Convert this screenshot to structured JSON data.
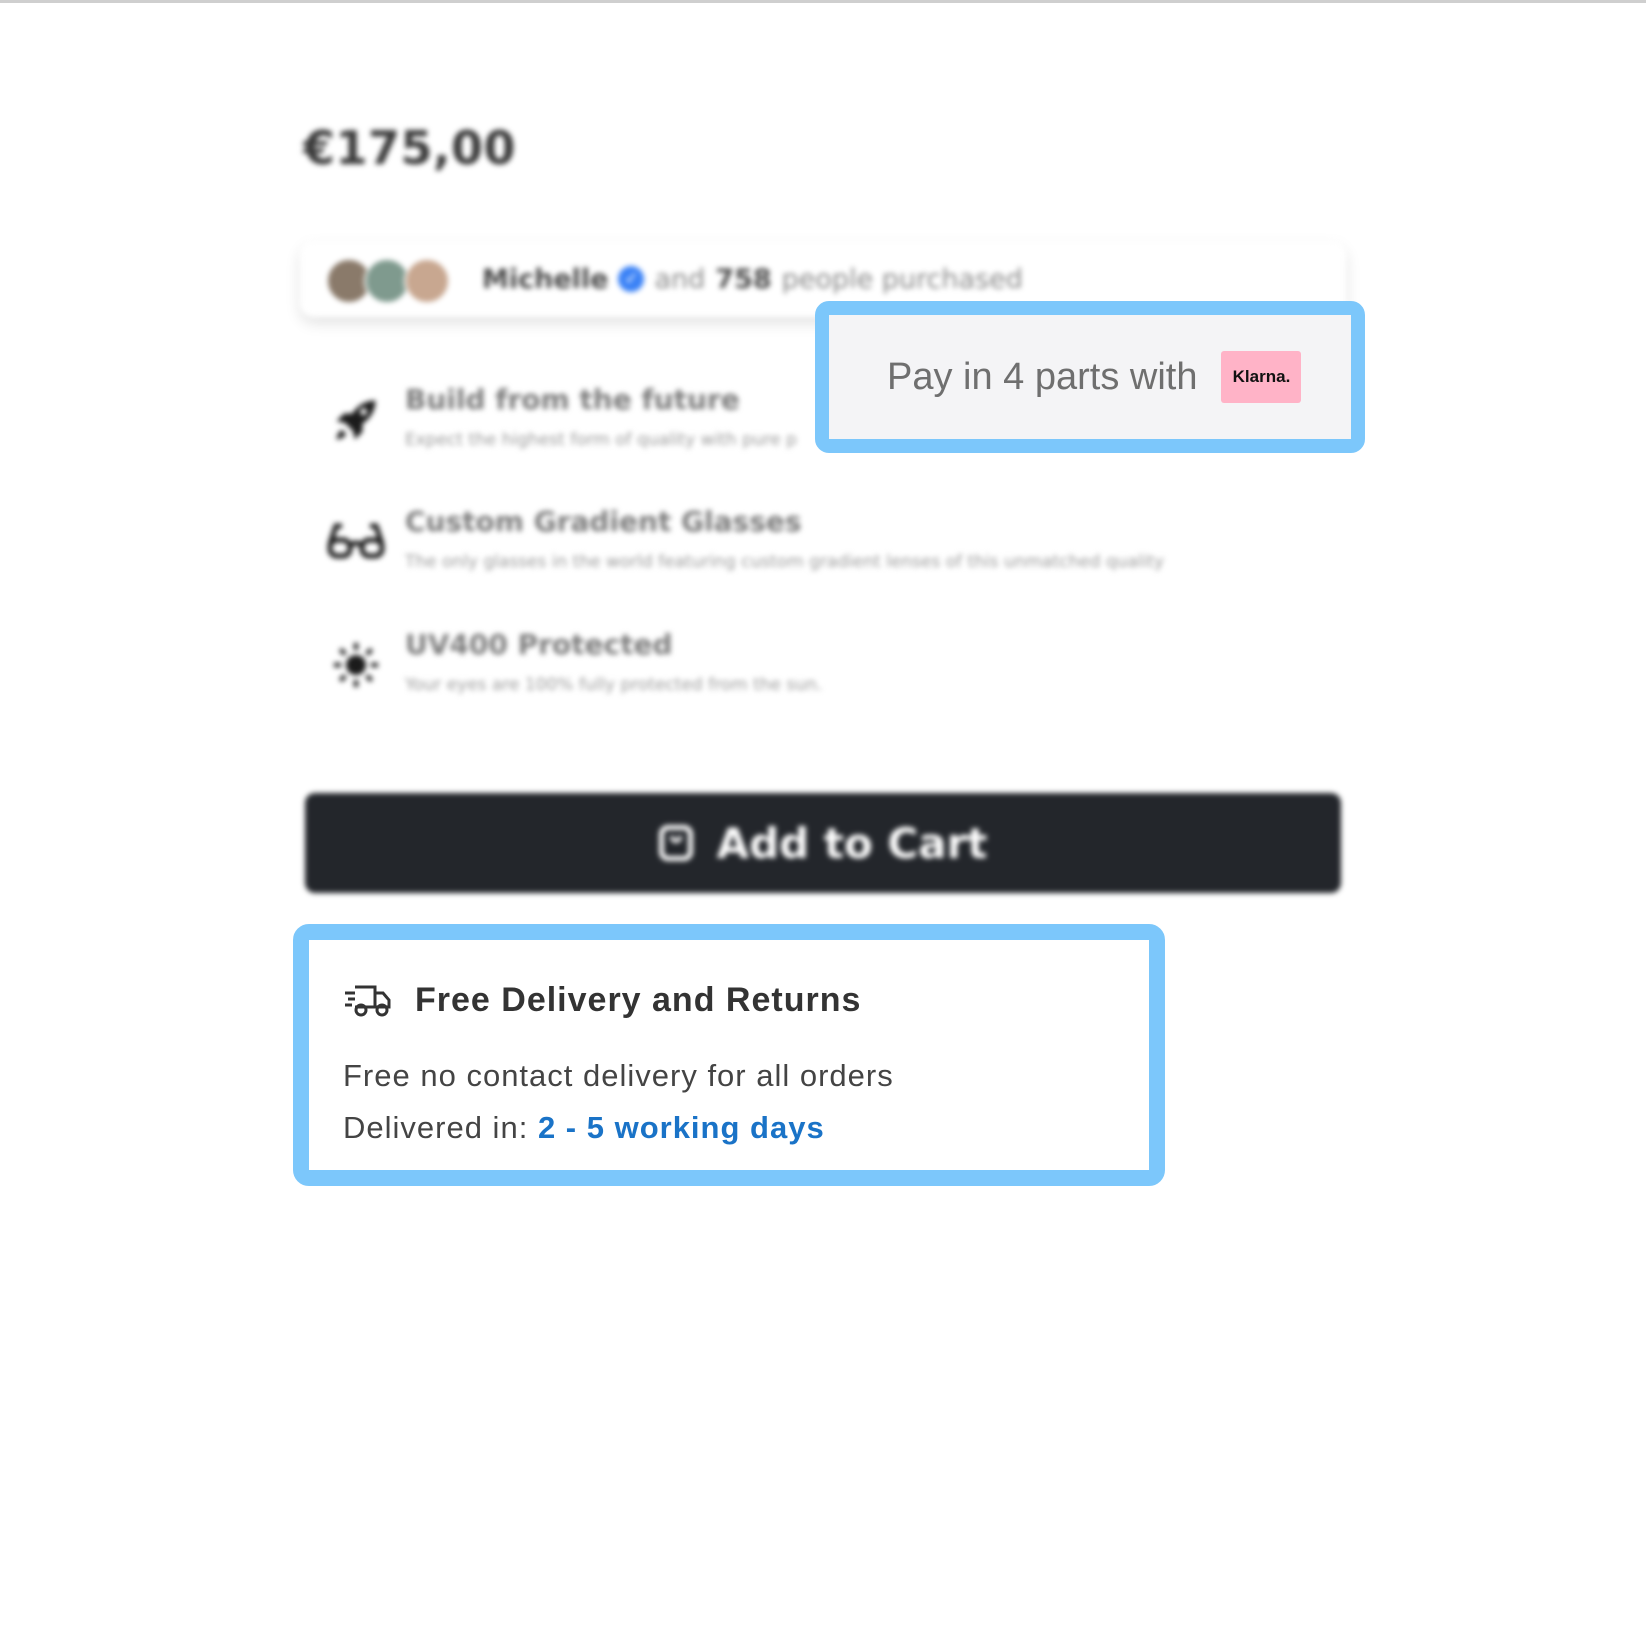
{
  "product": {
    "price": "€175,00"
  },
  "social_proof": {
    "name": "Michelle",
    "and_text": "and",
    "count": "758",
    "suffix": "people purchased"
  },
  "features": [
    {
      "icon": "rocket-icon",
      "title": "Build from the future",
      "description": "Expect the highest form of quality with pure p"
    },
    {
      "icon": "glasses-icon",
      "title": "Custom Gradient Glasses",
      "description": "The only glasses in the world featuring custom gradient lenses of this unmatched quality"
    },
    {
      "icon": "sun-icon",
      "title": "UV400 Protected",
      "description": "Your eyes are 100% fully protected from the sun."
    }
  ],
  "klarna": {
    "text": "Pay in 4 parts with",
    "badge": "Klarna."
  },
  "cart": {
    "label": "Add to Cart"
  },
  "delivery": {
    "title": "Free Delivery and Returns",
    "line1": "Free no contact delivery for all orders",
    "line2_prefix": "Delivered in:",
    "line2_days": "2 - 5 working days"
  },
  "colors": {
    "highlight_border": "#7cc7fb",
    "button_bg": "#23262b",
    "klarna_pink": "#ffb3c7",
    "days_blue": "#1a73c7"
  }
}
